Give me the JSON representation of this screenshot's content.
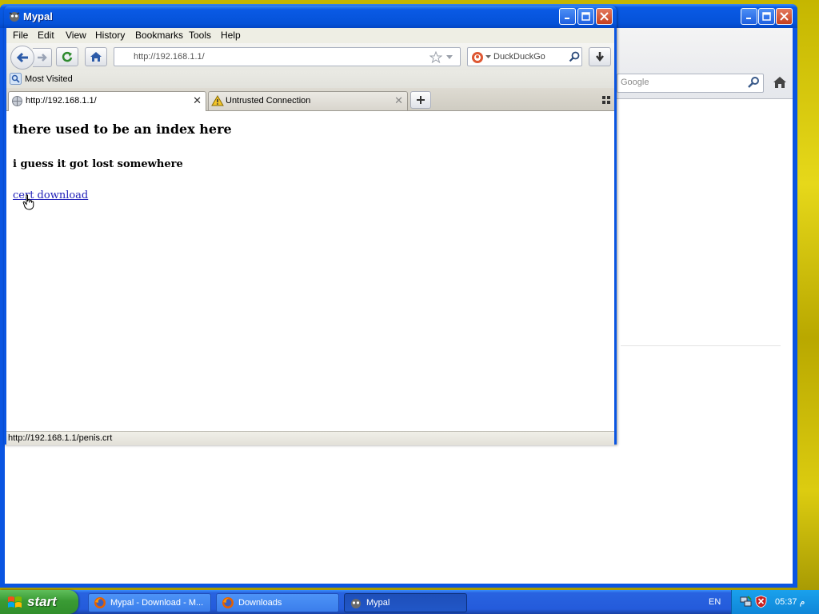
{
  "background_window": {
    "search_placeholder": "Google"
  },
  "window": {
    "title": "Mypal",
    "menu": [
      "File",
      "Edit",
      "View",
      "History",
      "Bookmarks",
      "Tools",
      "Help"
    ],
    "url": "http://192.168.1.1/",
    "search_engine": "DuckDuckGo",
    "bookmarks": {
      "most_visited": "Most Visited"
    },
    "tabs": [
      {
        "label": "http://192.168.1.1/",
        "active": true,
        "icon": "globe-icon"
      },
      {
        "label": "Untrusted Connection",
        "active": false,
        "icon": "warning-icon"
      }
    ],
    "content": {
      "heading": "there used to be an index here",
      "subheading": "i guess it got lost somewhere",
      "link": "cert download"
    },
    "status": "http://192.168.1.1/penis.crt"
  },
  "taskbar": {
    "start": "start",
    "items": [
      {
        "label": "Mypal - Download - M...",
        "icon": "firefox-icon",
        "active": false
      },
      {
        "label": "Downloads",
        "icon": "firefox-icon",
        "active": false
      },
      {
        "label": "Mypal",
        "icon": "mypal-icon",
        "active": true
      }
    ],
    "language": "EN",
    "clock": "05:37 م"
  },
  "colors": {
    "titlebar": "#0552d8",
    "taskbar": "#245bdb",
    "start": "#3a9b34",
    "link": "#1f1fb8"
  }
}
